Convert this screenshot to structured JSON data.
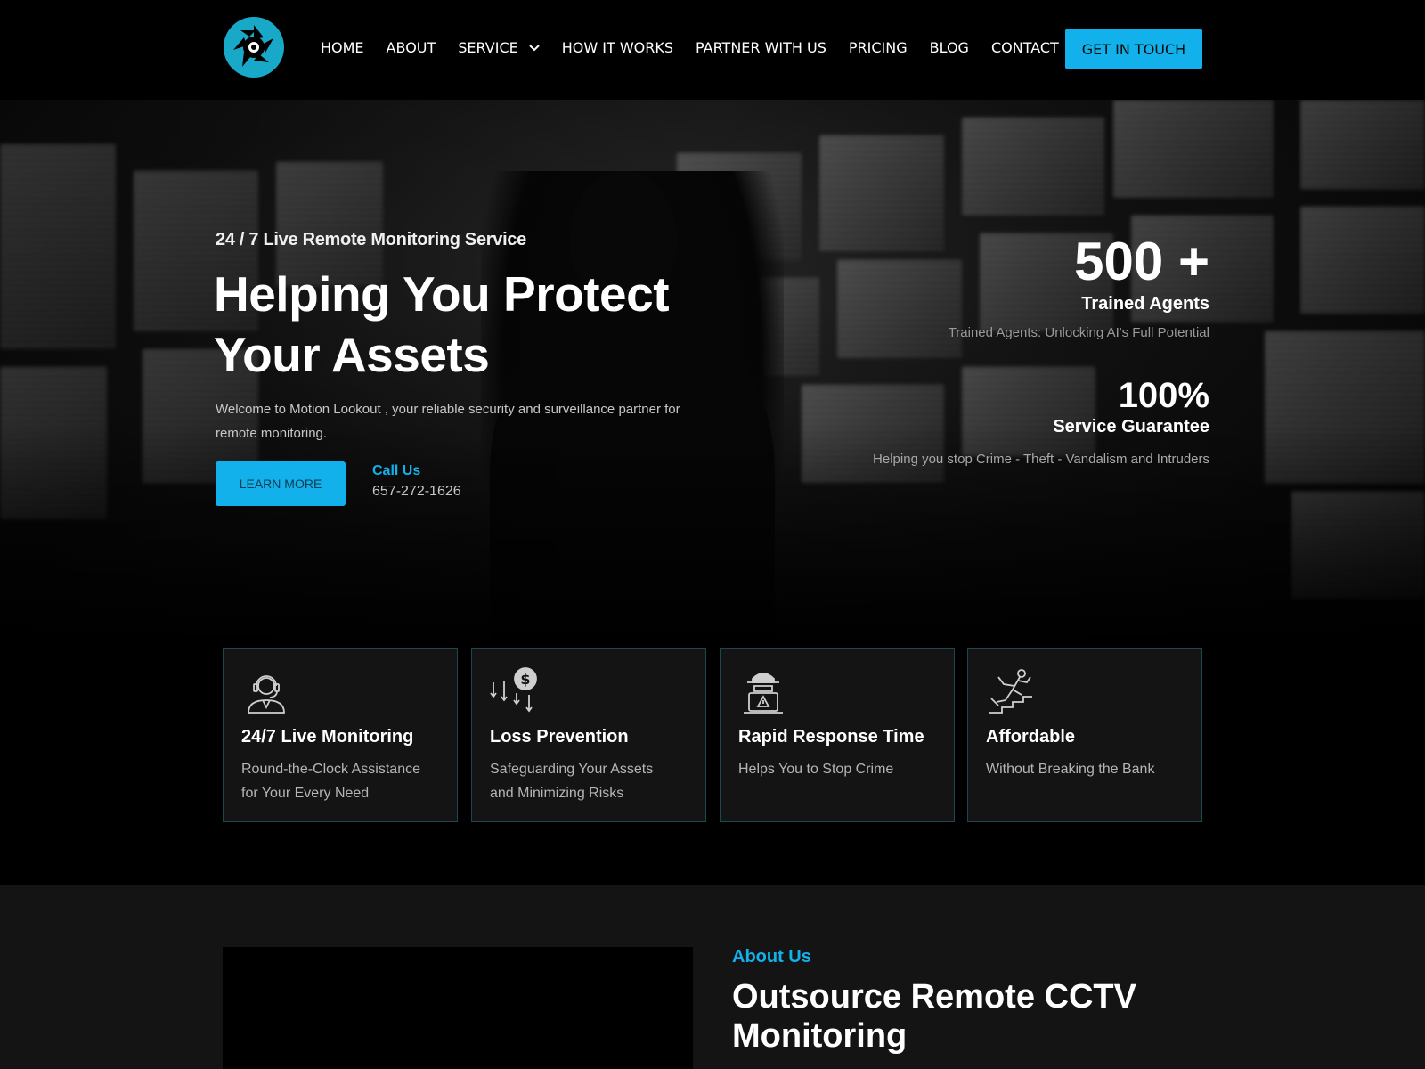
{
  "nav": {
    "items": [
      {
        "label": "HOME"
      },
      {
        "label": "ABOUT"
      },
      {
        "label": "SERVICE",
        "has_dropdown": true
      },
      {
        "label": "HOW IT WORKS"
      },
      {
        "label": "PARTNER WITH US"
      },
      {
        "label": "PRICING"
      },
      {
        "label": "BLOG"
      },
      {
        "label": "CONTACT"
      }
    ],
    "cta_label": "GET IN TOUCH",
    "logo_icon": "camera-shutter-icon"
  },
  "hero": {
    "tagline": "24 / 7 Live Remote Monitoring Service",
    "title": "Helping You Protect Your Assets",
    "description": "Welcome to Motion Lookout , your reliable security and surveillance partner for remote monitoring.",
    "learn_more_label": "LEARN MORE",
    "call_label": "Call Us",
    "call_phone": "657-272-1626",
    "stats": [
      {
        "number": "500 +",
        "label": "Trained Agents",
        "description": "Trained Agents: Unlocking AI's Full Potential"
      },
      {
        "number": "100%",
        "label": "Service Guarantee",
        "description": "Helping you stop Crime - Theft - Vandalism and Intruders"
      }
    ]
  },
  "features": [
    {
      "icon": "support-agent-icon",
      "title": "24/7 Live Monitoring",
      "text": "Round-the-Clock Assistance for Your Every Need"
    },
    {
      "icon": "dollar-loss-icon",
      "title": "Loss Prevention",
      "text": "Safeguarding Your Assets and Minimizing Risks"
    },
    {
      "icon": "hacker-alert-icon",
      "title": "Rapid Response Time",
      "text": "Helps You to Stop Crime"
    },
    {
      "icon": "falling-stairs-icon",
      "title": "Affordable",
      "text": "Without Breaking the Bank"
    }
  ],
  "about": {
    "tag": "About Us",
    "title": "Outsource Remote CCTV Monitoring"
  },
  "colors": {
    "accent": "#12b1eb",
    "background": "#000000",
    "card_bg": "#141414",
    "card_border": "#1c4652"
  }
}
